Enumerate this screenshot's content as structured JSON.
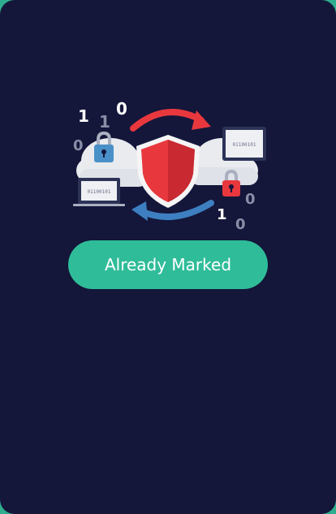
{
  "button": {
    "label": "Already Marked"
  },
  "illustration": {
    "digits": {
      "d1": "1",
      "d2": "0",
      "d3": "1",
      "d4": "0",
      "d5": "1",
      "d6": "0",
      "d7": "0"
    },
    "left_laptop_code": "01100101",
    "right_monitor_code": "01100101",
    "icons": [
      "cloud-icon",
      "shield-icon",
      "padlock-icon",
      "laptop-icon",
      "monitor-icon",
      "sync-arrow-icon"
    ]
  },
  "colors": {
    "background": "#14163a",
    "accent": "#2fbc99",
    "shield_red": "#e8383e",
    "arrow_blue": "#3d7fc0",
    "lock_blue": "#4a90c8"
  }
}
